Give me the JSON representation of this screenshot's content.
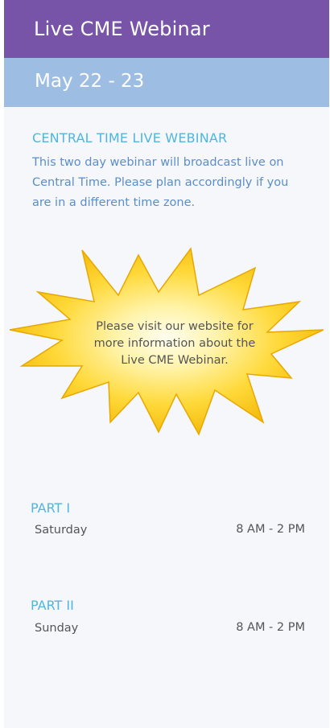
{
  "header": {
    "title": "Live CME Webinar",
    "dates": "May 22 - 23"
  },
  "intro": {
    "heading": "CENTRAL TIME LIVE WEBINAR",
    "body": "This two day webinar will broadcast live on Central Time. Please plan accordingly if you are in a different time zone."
  },
  "burst": {
    "message": "Please visit our website for more information about the Live CME Webinar."
  },
  "schedule": [
    {
      "part": "PART I",
      "day": "Saturday",
      "time": "8 AM - 2 PM"
    },
    {
      "part": "PART II",
      "day": "Sunday",
      "time": "8 AM - 2 PM"
    }
  ],
  "colors": {
    "title_bar": "#7754a8",
    "date_bar": "#9dbde3",
    "accent_heading": "#4fb6e0",
    "body_text": "#5b8ec9",
    "burst_fill": "#f7c51c"
  }
}
